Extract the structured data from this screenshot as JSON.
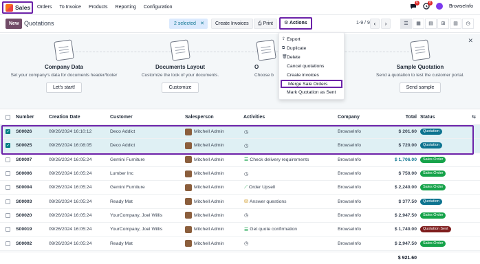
{
  "app": {
    "name": "Sales"
  },
  "menu": [
    "Orders",
    "To Invoice",
    "Products",
    "Reporting",
    "Configuration"
  ],
  "nav_right": {
    "badge_messages": "6",
    "badge_activities": "8",
    "company": "BrowseInfo"
  },
  "control": {
    "new_label": "New",
    "title": "Quotations",
    "selected_label": "2 selected",
    "create_invoices_label": "Create Invoices",
    "print_label": "Print",
    "actions_label": "Actions",
    "pager": "1-9 / 9"
  },
  "actions_menu": [
    "Export",
    "Duplicate",
    "Delete",
    "Cancel quotations",
    "Create invoices",
    "Merge Sale Orders",
    "Mark Quotation as Sent"
  ],
  "banner": {
    "steps": [
      {
        "title": "Company Data",
        "desc": "Set your company's data for documents header/footer",
        "button": "Let's start!"
      },
      {
        "title": "Documents Layout",
        "desc": "Customize the look of your documents.",
        "button": "Customize"
      },
      {
        "title": "O",
        "desc": "Choose b",
        "button": ""
      },
      {
        "title": "Sample Quotation",
        "desc": "Send a quotation to test the customer portal.",
        "button": "Send sample"
      }
    ]
  },
  "table": {
    "headers": {
      "number": "Number",
      "date": "Creation Date",
      "customer": "Customer",
      "salesperson": "Salesperson",
      "activities": "Activities",
      "company": "Company",
      "total": "Total",
      "status": "Status"
    },
    "rows": [
      {
        "number": "S00026",
        "date": "09/26/2024 16:10:12",
        "customer": "Deco Addict",
        "salesperson": "Mitchell Admin",
        "activity": "",
        "activity_icon": "clock",
        "company": "BrowseInfo",
        "total": "$ 201.60",
        "status": "Quotation",
        "selected": true
      },
      {
        "number": "S00025",
        "date": "09/26/2024 16:08:05",
        "customer": "Deco Addict",
        "salesperson": "Mitchell Admin",
        "activity": "",
        "activity_icon": "clock",
        "company": "BrowseInfo",
        "total": "$ 720.00",
        "status": "Quotation",
        "selected": true
      },
      {
        "number": "S00007",
        "date": "09/26/2024 16:05:24",
        "customer": "Gemini Furniture",
        "salesperson": "Mitchell Admin",
        "activity": "Check delivery requirements",
        "activity_icon": "tasks",
        "company": "BrowseInfo",
        "total": "$ 1,706.00",
        "status": "Sales Order",
        "selected": false
      },
      {
        "number": "S00006",
        "date": "09/26/2024 16:05:24",
        "customer": "Lumber Inc",
        "salesperson": "Mitchell Admin",
        "activity": "",
        "activity_icon": "clock",
        "company": "BrowseInfo",
        "total": "$ 750.00",
        "status": "Sales Order",
        "selected": false
      },
      {
        "number": "S00004",
        "date": "09/26/2024 16:05:24",
        "customer": "Gemini Furniture",
        "salesperson": "Mitchell Admin",
        "activity": "Order Upsell",
        "activity_icon": "chart",
        "company": "BrowseInfo",
        "total": "$ 2,240.00",
        "status": "Sales Order",
        "selected": false
      },
      {
        "number": "S00003",
        "date": "09/26/2024 16:05:24",
        "customer": "Ready Mat",
        "salesperson": "Mitchell Admin",
        "activity": "Answer questions",
        "activity_icon": "mail",
        "company": "BrowseInfo",
        "total": "$ 377.50",
        "status": "Quotation",
        "selected": false
      },
      {
        "number": "S00020",
        "date": "09/26/2024 16:05:24",
        "customer": "YourCompany, Joel Willis",
        "salesperson": "Mitchell Admin",
        "activity": "",
        "activity_icon": "clock",
        "company": "BrowseInfo",
        "total": "$ 2,947.50",
        "status": "Sales Order",
        "selected": false
      },
      {
        "number": "S00019",
        "date": "09/26/2024 16:05:24",
        "customer": "YourCompany, Joel Willis",
        "salesperson": "Mitchell Admin",
        "activity": "Get quote confirmation",
        "activity_icon": "tasks",
        "company": "BrowseInfo",
        "total": "$ 1,740.00",
        "status": "Quotation Sent",
        "selected": false
      },
      {
        "number": "S00002",
        "date": "09/26/2024 16:05:24",
        "customer": "Ready Mat",
        "salesperson": "Mitchell Admin",
        "activity": "",
        "activity_icon": "clock",
        "company": "BrowseInfo",
        "total": "$ 2,947.50",
        "status": "Sales Order",
        "selected": false
      }
    ],
    "grand_total": "$ 921.60"
  }
}
